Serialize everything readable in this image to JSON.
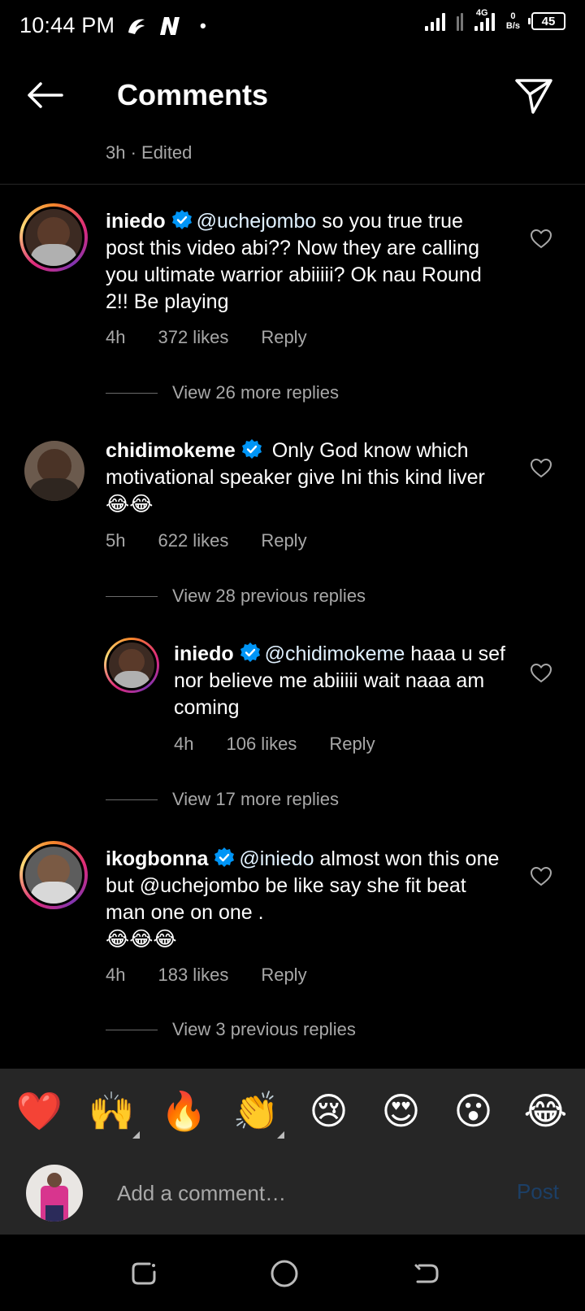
{
  "status_bar": {
    "time": "10:44 PM",
    "network_type": "4G",
    "speed_value": "0",
    "speed_unit": "B/s",
    "battery": "45"
  },
  "header": {
    "title": "Comments"
  },
  "post_meta": "3h · Edited",
  "comments": [
    {
      "username": "iniedo",
      "mention": "@uchejombo",
      "text": " so you true true post this video abi?? Now they are calling you ultimate warrior abiiiii? Ok nau Round 2!! Be playing",
      "time": "4h",
      "likes": "372 likes",
      "reply_label": "Reply",
      "view_more": "View 26 more replies"
    },
    {
      "username": "chidimokeme",
      "mention": "",
      "text": " Only God know which motivational speaker give Ini this kind liver 😂😂",
      "time": "5h",
      "likes": "622 likes",
      "reply_label": "Reply",
      "view_more": "View 28 previous replies"
    },
    {
      "username": "iniedo",
      "mention": "@chidimokeme",
      "text": " haaa u sef nor believe me abiiiii wait naaa am coming",
      "time": "4h",
      "likes": "106 likes",
      "reply_label": "Reply",
      "view_more": "View 17 more replies"
    },
    {
      "username": "ikogbonna",
      "mention": "@iniedo",
      "text": " almost won this one but @uchejombo be like say she fit beat man one on one .",
      "text2": "😂😂😂",
      "time": "4h",
      "likes": "183 likes",
      "reply_label": "Reply",
      "view_more": "View 3 previous replies"
    }
  ],
  "emoji_bar": [
    "❤️",
    "🙌",
    "🔥",
    "👏",
    "😢",
    "😍",
    "😮",
    "😂"
  ],
  "input": {
    "placeholder": "Add a comment…",
    "post_label": "Post"
  },
  "colors": {
    "background": "#000000",
    "secondary_text": "#a8a8a8",
    "verified": "#0095f6",
    "post_disabled": "#1c3f66",
    "panel": "#262626"
  }
}
